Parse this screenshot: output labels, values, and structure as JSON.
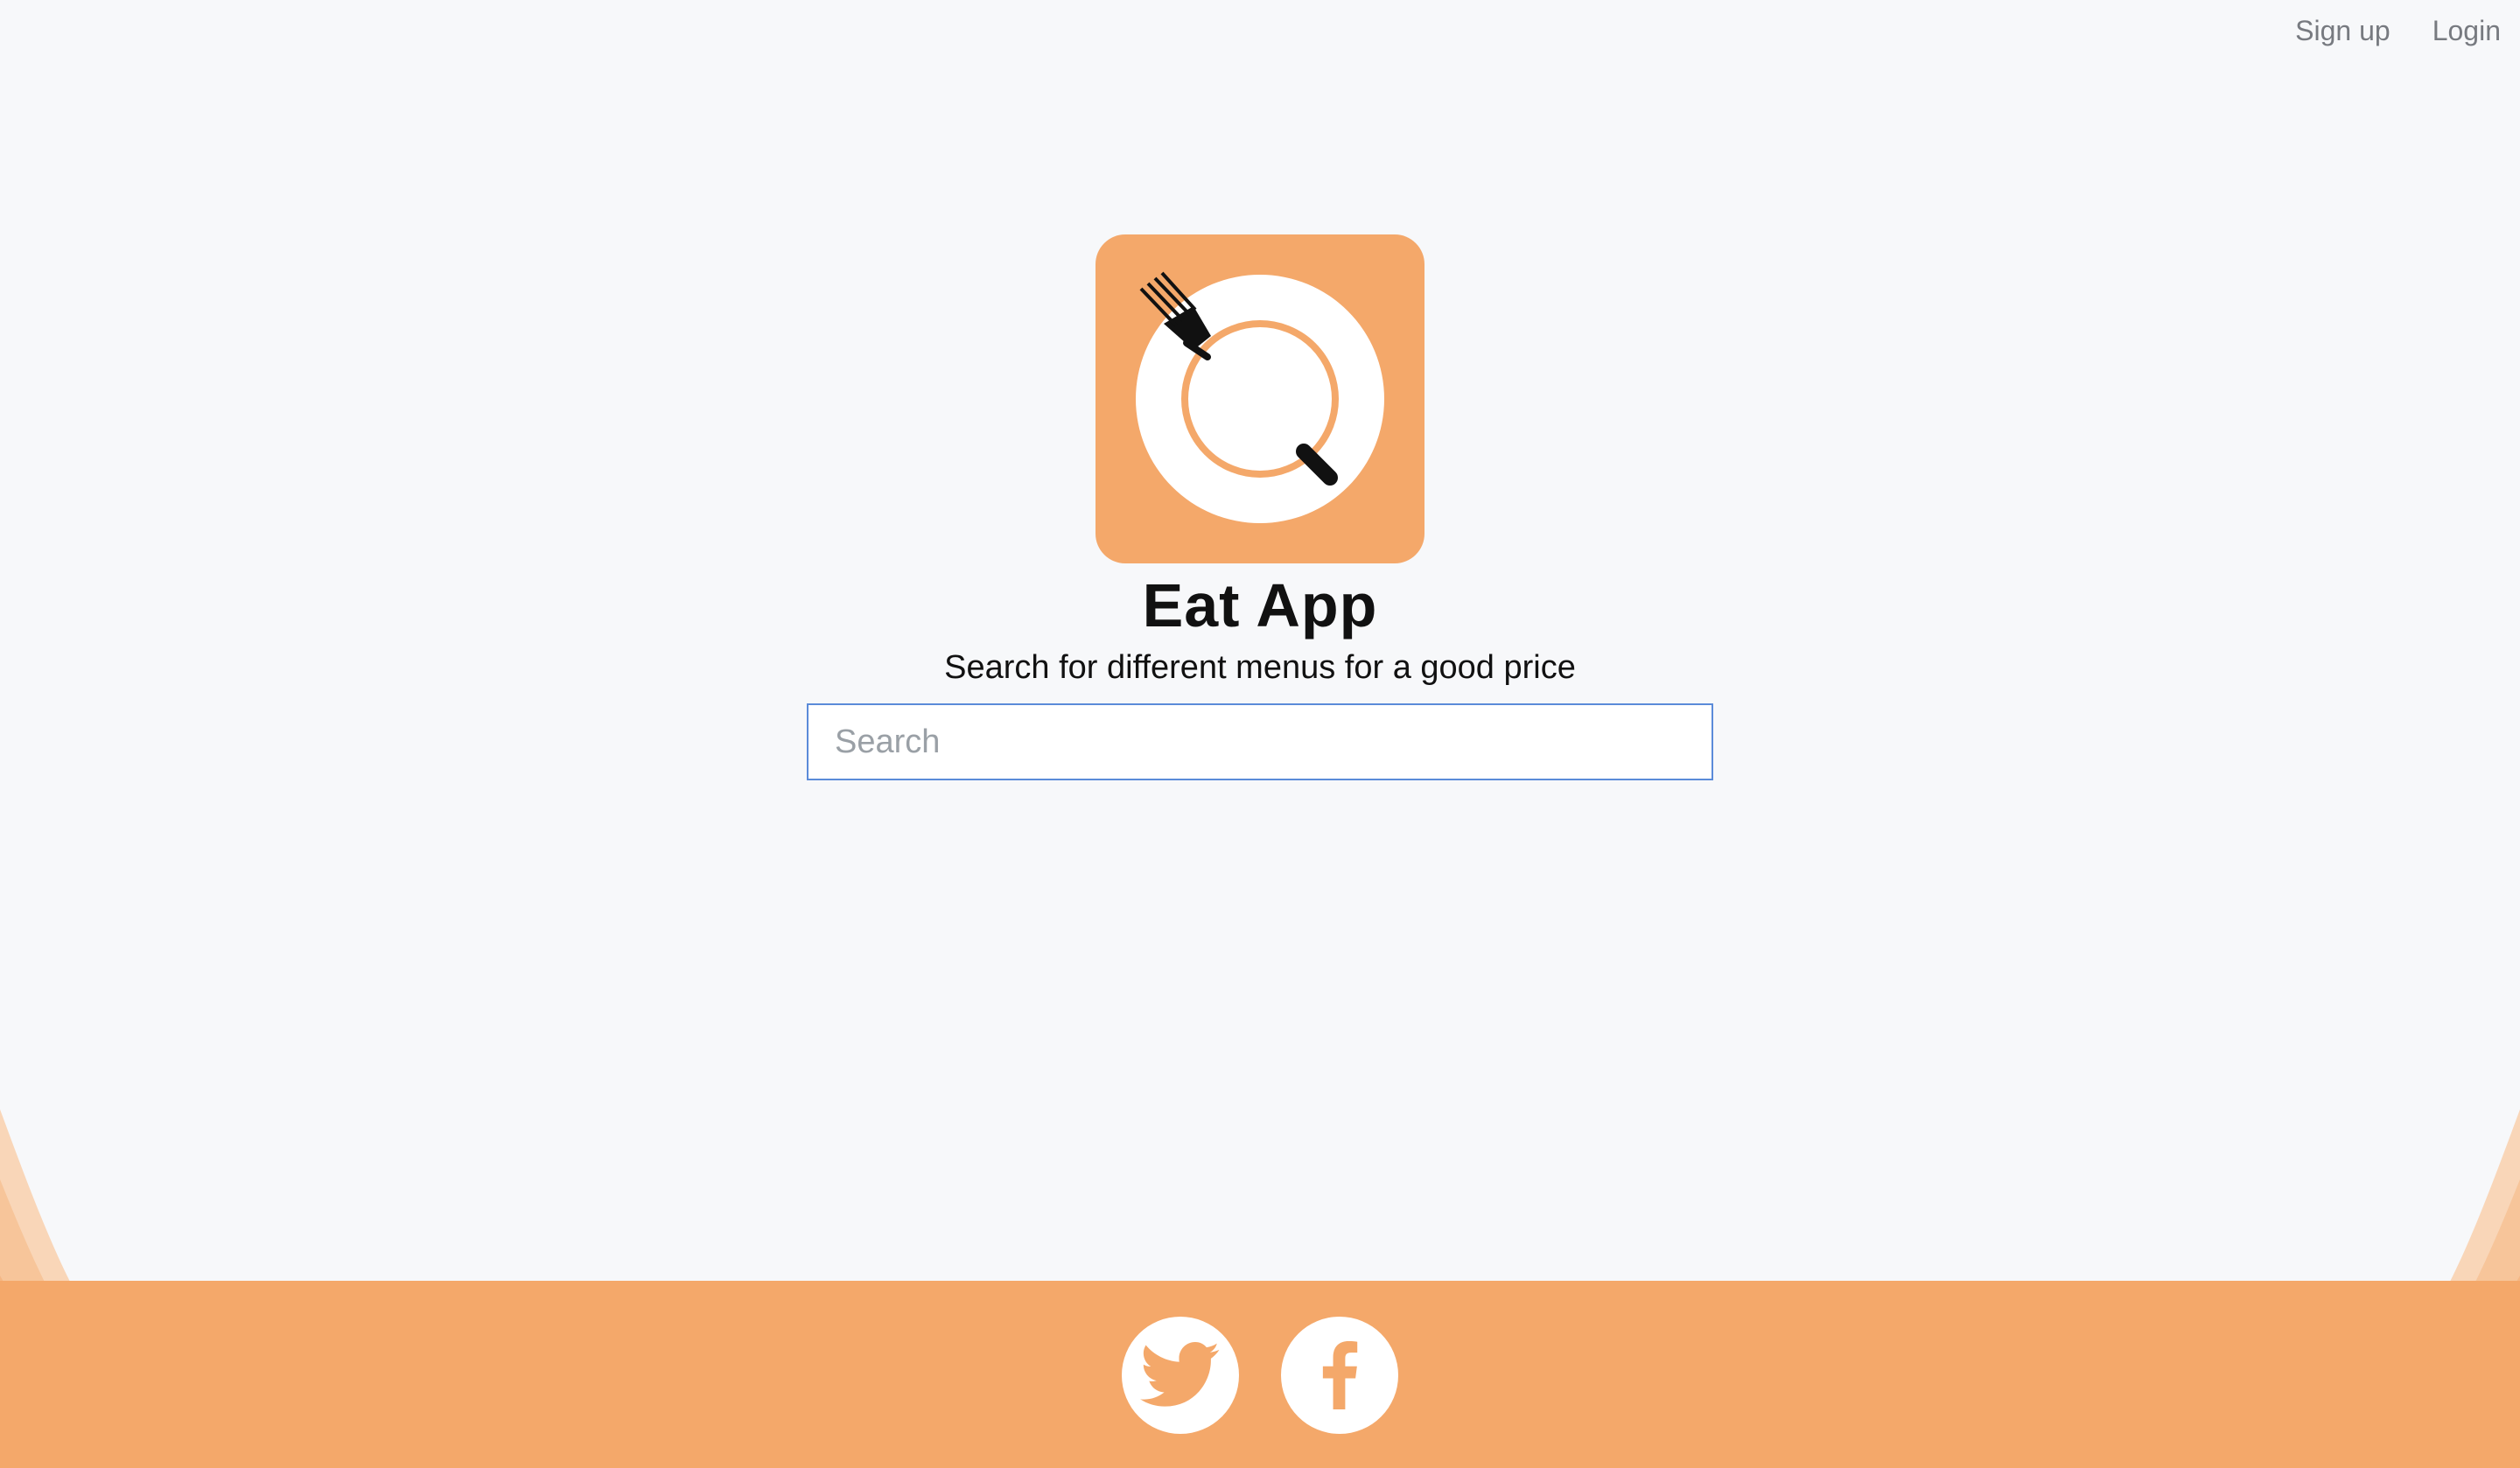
{
  "nav": {
    "signup_label": "Sign up",
    "login_label": "Login"
  },
  "hero": {
    "title": "Eat App",
    "subtitle": "Search for different menus for a good price"
  },
  "search": {
    "placeholder": "Search",
    "value": ""
  },
  "social": {
    "twitter_icon": "twitter-icon",
    "facebook_icon": "facebook-icon"
  },
  "colors": {
    "brand_orange": "#f4a86a",
    "background": "#f7f8fa",
    "search_border": "#5b8bd9"
  },
  "logo_icon": "plate-fork-icon"
}
